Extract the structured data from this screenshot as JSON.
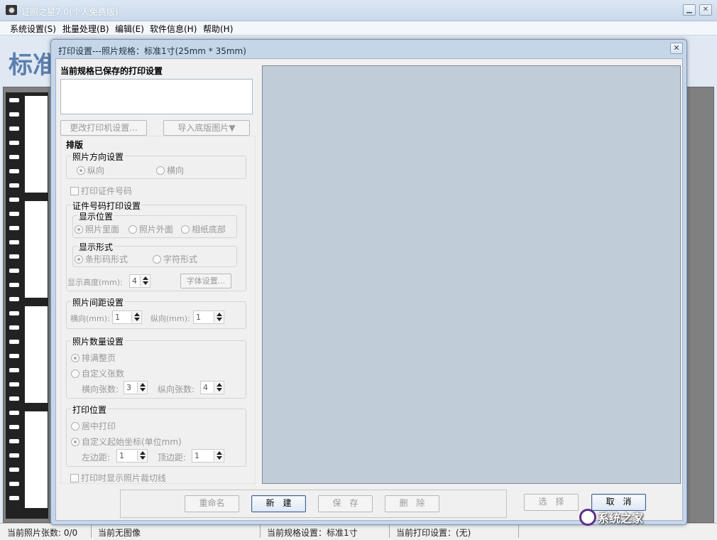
{
  "main_window": {
    "title": "证照之星7.0(个人免费版)",
    "minimize_glyph": "▁",
    "close_glyph": "✕",
    "menu": [
      "系统设置(S)",
      "批量处理(B)",
      "编辑(E)",
      "软件信息(H)",
      "帮助(H)"
    ],
    "big_label": "标准",
    "status": [
      "当前照片张数: 0/0",
      "当前无图像",
      "当前规格设置：标准1寸",
      "当前打印设置：(无)"
    ]
  },
  "dialog": {
    "title": "打印设置---照片规格：标准1寸(25mm * 35mm)",
    "close_glyph": "✕",
    "saved_title": "当前规格已保存的打印设置",
    "btn_change_printer": "更改打印机设置...",
    "btn_import_bg": "导入底版图片▼",
    "layout_title": "排版",
    "orientation": {
      "label": "照片方向设置",
      "portrait": "纵向",
      "landscape": "横向"
    },
    "print_id_checkbox": "打印证件号码",
    "id_print": {
      "label": "证件号码打印设置",
      "position_label": "显示位置",
      "pos_inside": "照片里面",
      "pos_outside": "照片外面",
      "pos_bottom": "相纸底部",
      "form_label": "显示形式",
      "form_barcode": "条形码形式",
      "form_char": "字符形式",
      "height_label": "显示高度(mm):",
      "height_value": "4",
      "font_button": "字体设置..."
    },
    "spacing": {
      "label": "照片间距设置",
      "h_label": "横向(mm):",
      "h_value": "1",
      "v_label": "纵向(mm):",
      "v_value": "1"
    },
    "count": {
      "label": "照片数量设置",
      "fill_page": "排满整页",
      "custom": "自定义张数",
      "h_count_label": "横向张数:",
      "h_count_value": "3",
      "v_count_label": "纵向张数:",
      "v_count_value": "4"
    },
    "position": {
      "label": "打印位置",
      "center": "居中打印",
      "custom_coords": "自定义起始坐标(单位mm)",
      "left_label": "左边距:",
      "left_value": "1",
      "top_label": "顶边距:",
      "top_value": "1"
    },
    "cut_line_checkbox": "打印时显示照片裁切线",
    "buttons": {
      "rename": "重命名",
      "new": "新　建",
      "save": "保　存",
      "delete": "删　除",
      "select": "选　择",
      "cancel": "取　消"
    }
  },
  "watermark": "系统之家",
  "colors": {
    "dialog_frame": "#c6d6e9",
    "preview_bg": "#c0cdd9",
    "accent_text": "#5d7fae"
  }
}
